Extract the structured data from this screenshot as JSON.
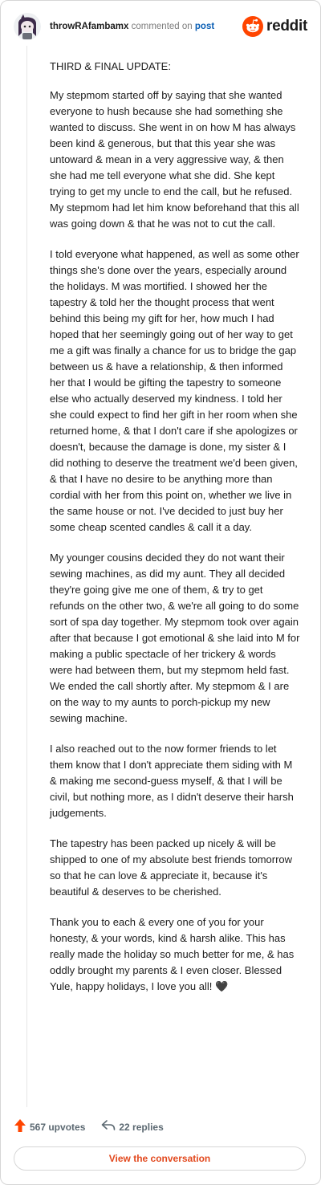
{
  "header": {
    "username": "throwRAfambamx",
    "verb": "commented on",
    "target": "post",
    "brand": "reddit",
    "avatar_icon": "snoo-avatar-icon",
    "logo_icon": "reddit-alien-logo-icon",
    "brand_color": "#ff4500"
  },
  "comment": {
    "paragraphs": [
      "THIRD & FINAL UPDATE:",
      "My stepmom started off by saying that she wanted everyone to hush because she had something she wanted to discuss. She went in on how M has always been kind & generous, but that this year she was untoward & mean in a very aggressive way, & then she had me tell everyone what she did. She kept trying to get my uncle to end the call, but he refused. My stepmom had let him know beforehand that this all was going down & that he was not to cut the call.",
      "I told everyone what happened, as well as some other things she's done over the years, especially around the holidays. M was mortified. I showed her the tapestry & told her the thought process that went behind this being my gift for her, how much I had hoped that her seemingly going out of her way to get me a gift was finally a chance for us to bridge the gap between us & have a relationship, & then informed her that I would be gifting the tapestry to someone else who actually deserved my kindness. I told her she could expect to find her gift in her room when she returned home, & that I don't care if she apologizes or doesn't, because the damage is done, my sister & I did nothing to deserve the treatment we'd been given, & that I have no desire to be anything more than cordial with her from this point on, whether we live in the same house or not. I've decided to just buy her some cheap scented candles & call it a day.",
      "My younger cousins decided they do not want their sewing machines, as did my aunt. They all decided they're going give me one of them, & try to get refunds on the other two, & we're all going to do some sort of spa day together. My stepmom took over again after that because I got emotional & she laid into M for making a public spectacle of her trickery & words were had between them, but my stepmom held fast. We ended the call shortly after. My stepmom & I are on the way to my aunts to porch-pickup my new sewing machine.",
      "I also reached out to the now former friends to let them know that I don't appreciate them siding with M & making me second-guess myself, & that I will be civil, but nothing more, as I didn't deserve their harsh judgements.",
      "The tapestry has been packed up nicely & will be shipped to one of my absolute best friends tomorrow so that he can love & appreciate it, because it's beautiful & deserves to be cherished.",
      "Thank you to each & every one of you for your honesty, & your words, kind & harsh alike. This has really made the holiday so much better for me, & has oddly brought my parents & I even closer. Blessed Yule, happy holidays, I love you all! 🖤"
    ]
  },
  "footer": {
    "upvotes": "567 upvotes",
    "replies": "22 replies",
    "upvote_icon": "upvote-arrow-icon",
    "reply_icon": "reply-arrow-icon",
    "upvote_color": "#ff4500"
  },
  "cta": {
    "label": "View the conversation",
    "color": "#e2481d"
  }
}
